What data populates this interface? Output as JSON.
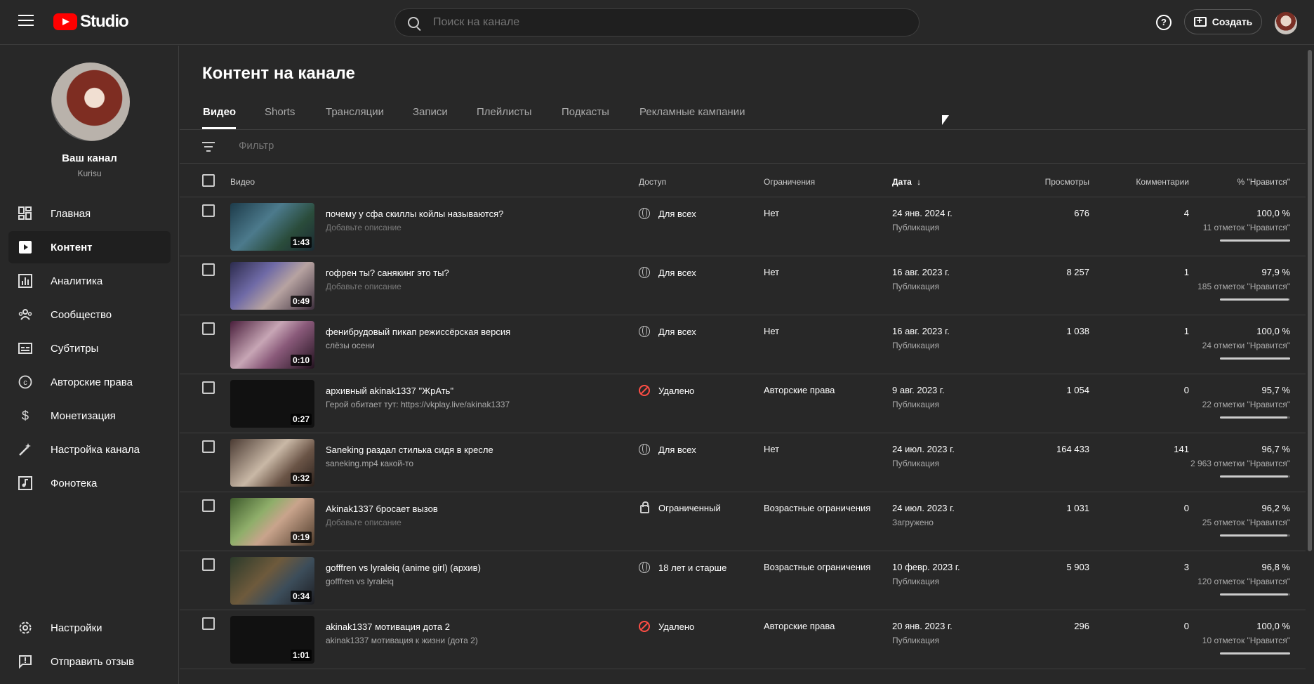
{
  "header": {
    "logo_text": "Studio",
    "search_placeholder": "Поиск на канале",
    "create_label": "Создать",
    "help_symbol": "?"
  },
  "channel": {
    "name": "Ваш канал",
    "handle": "Kurisu"
  },
  "sidebar": {
    "items": [
      {
        "label": "Главная",
        "icon": "dashboard-icon",
        "active": false
      },
      {
        "label": "Контент",
        "icon": "content-icon",
        "active": true
      },
      {
        "label": "Аналитика",
        "icon": "analytics-icon",
        "active": false
      },
      {
        "label": "Сообщество",
        "icon": "community-icon",
        "active": false
      },
      {
        "label": "Субтитры",
        "icon": "subtitles-icon",
        "active": false
      },
      {
        "label": "Авторские права",
        "icon": "copyright-icon",
        "active": false
      },
      {
        "label": "Монетизация",
        "icon": "monetization-icon",
        "active": false
      },
      {
        "label": "Настройка канала",
        "icon": "customization-icon",
        "active": false
      },
      {
        "label": "Фонотека",
        "icon": "audio-library-icon",
        "active": false
      }
    ],
    "bottom": [
      {
        "label": "Настройки",
        "icon": "settings-icon"
      },
      {
        "label": "Отправить отзыв",
        "icon": "feedback-icon"
      }
    ]
  },
  "main": {
    "title": "Контент на канале",
    "tabs": [
      {
        "label": "Видео",
        "active": true
      },
      {
        "label": "Shorts",
        "active": false
      },
      {
        "label": "Трансляции",
        "active": false
      },
      {
        "label": "Записи",
        "active": false
      },
      {
        "label": "Плейлисты",
        "active": false
      },
      {
        "label": "Подкасты",
        "active": false
      },
      {
        "label": "Рекламные кампании",
        "active": false
      }
    ],
    "filter_placeholder": "Фильтр",
    "columns": {
      "video": "Видео",
      "access": "Доступ",
      "restrictions": "Ограничения",
      "date": "Дата",
      "views": "Просмотры",
      "comments": "Комментарии",
      "likes": "% \"Нравится\""
    }
  },
  "videos": [
    {
      "title": "почему у сфа скиллы койлы называются?",
      "desc": "Добавьте описание",
      "desc_placeholder": true,
      "duration": "1:43",
      "access": "Для всех",
      "access_icon": "globe-icon",
      "restriction": "Нет",
      "date": "24 янв. 2024 г.",
      "status": "Публикация",
      "views": "676",
      "comments": "4",
      "likes": "100,0 %",
      "likes_count": "11 отметок \"Нравится\"",
      "like_ratio": 1.0,
      "thumb": "linear-gradient(135deg,#1d3b4a,#4c7a8c 40%,#2a4c3b 70%,#1b2a33)"
    },
    {
      "title": "гофрен ты? санякинг это ты?",
      "desc": "Добавьте описание",
      "desc_placeholder": true,
      "duration": "0:49",
      "access": "Для всех",
      "access_icon": "globe-icon",
      "restriction": "Нет",
      "date": "16 авг. 2023 г.",
      "status": "Публикация",
      "views": "8 257",
      "comments": "1",
      "likes": "97,9 %",
      "likes_count": "185 отметок \"Нравится\"",
      "like_ratio": 0.979,
      "thumb": "linear-gradient(135deg,#2c2b4d,#6f6aa6 35%,#b7a3a1 60%,#3d2f3d)"
    },
    {
      "title": "фенибрудовый пикап режиссёрская версия",
      "desc": "слёзы осени",
      "desc_placeholder": false,
      "duration": "0:10",
      "access": "Для всех",
      "access_icon": "globe-icon",
      "restriction": "Нет",
      "date": "16 авг. 2023 г.",
      "status": "Публикация",
      "views": "1 038",
      "comments": "1",
      "likes": "100,0 %",
      "likes_count": "24 отметки \"Нравится\"",
      "like_ratio": 1.0,
      "thumb": "linear-gradient(135deg,#4a1f3c,#c7a6b5 40%,#8a5a7a 60%,#22121f)"
    },
    {
      "title": "архивный akinak1337 \"ЖрАть\"",
      "desc": "Герой обитает тут: https://vkplay.live/akinak1337",
      "desc_placeholder": false,
      "duration": "0:27",
      "access": "Удалено",
      "access_icon": "blocked-icon",
      "restriction": "Авторские права",
      "date": "9 авг. 2023 г.",
      "status": "Публикация",
      "views": "1 054",
      "comments": "0",
      "likes": "95,7 %",
      "likes_count": "22 отметки \"Нравится\"",
      "like_ratio": 0.957,
      "thumb": "#111111"
    },
    {
      "title": "Saneking раздал стилька сидя в кресле",
      "desc": "saneking.mp4 какой-то",
      "desc_placeholder": false,
      "duration": "0:32",
      "access": "Для всех",
      "access_icon": "globe-icon",
      "restriction": "Нет",
      "date": "24 июл. 2023 г.",
      "status": "Публикация",
      "views": "164 433",
      "comments": "141",
      "likes": "96,7 %",
      "likes_count": "2 963 отметки \"Нравится\"",
      "like_ratio": 0.967,
      "thumb": "linear-gradient(135deg,#4b3b33,#c9b8a6 45%,#6a5446 70%,#2b211c)"
    },
    {
      "title": "Akinak1337 бросает вызов",
      "desc": "Добавьте описание",
      "desc_placeholder": true,
      "duration": "0:19",
      "access": "Ограниченный",
      "access_icon": "lock-icon",
      "restriction": "Возрастные ограничения",
      "date": "24 июл. 2023 г.",
      "status": "Загружено",
      "views": "1 031",
      "comments": "0",
      "likes": "96,2 %",
      "likes_count": "25 отметок \"Нравится\"",
      "like_ratio": 0.962,
      "thumb": "linear-gradient(135deg,#3e5a2c,#8fae6a 35%,#c9a48c 55%,#4d3a2a)"
    },
    {
      "title": "gofffren vs lyraleiq (anime girl) (архив)",
      "desc": "gofffren vs lyraleiq",
      "desc_placeholder": false,
      "duration": "0:34",
      "access": "18 лет и старше",
      "access_icon": "globe-icon",
      "restriction": "Возрастные ограничения",
      "date": "10 февр. 2023 г.",
      "status": "Публикация",
      "views": "5 903",
      "comments": "3",
      "likes": "96,8 %",
      "likes_count": "120 отметок \"Нравится\"",
      "like_ratio": 0.968,
      "thumb": "linear-gradient(135deg,#2b3a2a,#6e5a3c 40%,#3c4d5a 65%,#1d1d22)"
    },
    {
      "title": "akinak1337 мотивация дота 2",
      "desc": "akinak1337 мотивация к жизни (дота 2)",
      "desc_placeholder": false,
      "duration": "1:01",
      "access": "Удалено",
      "access_icon": "blocked-icon",
      "restriction": "Авторские права",
      "date": "20 янв. 2023 г.",
      "status": "Публикация",
      "views": "296",
      "comments": "0",
      "likes": "100,0 %",
      "likes_count": "10 отметок \"Нравится\"",
      "like_ratio": 1.0,
      "thumb": "#111111"
    }
  ]
}
